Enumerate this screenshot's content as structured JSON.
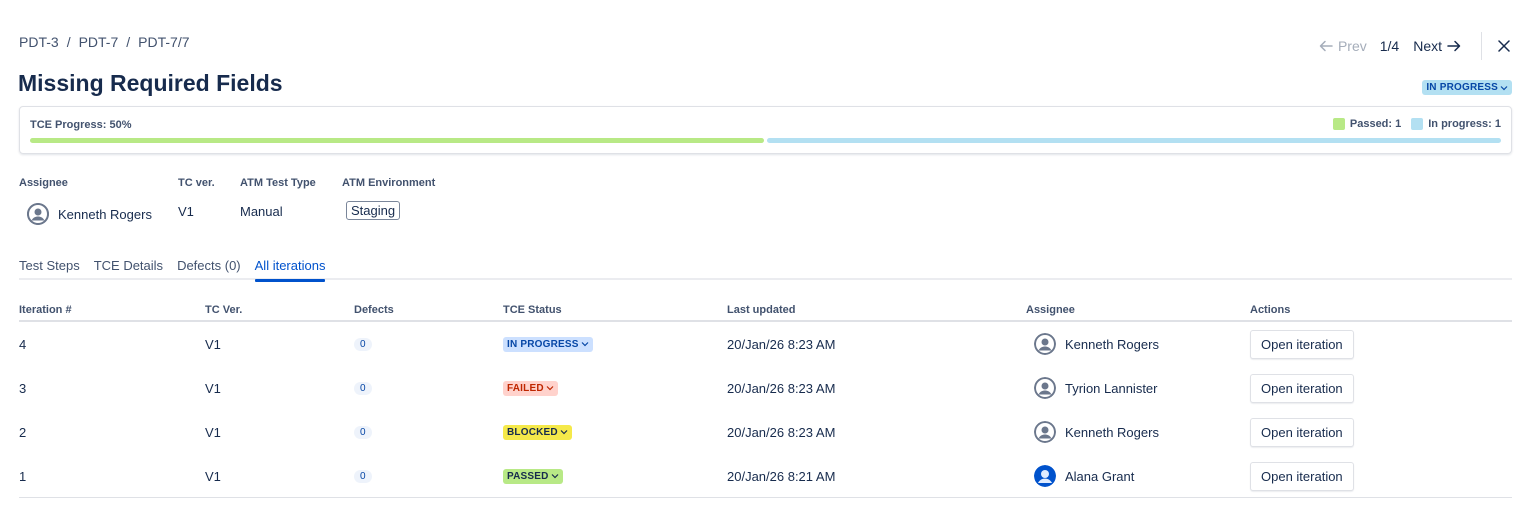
{
  "breadcrumb": {
    "items": [
      "PDT-3",
      "PDT-7",
      "PDT-7/7"
    ],
    "separator": "/"
  },
  "pager": {
    "prev_label": "Prev",
    "count": "1/4",
    "next_label": "Next"
  },
  "page_title": "Missing Required Fields",
  "header_status": "IN PROGRESS",
  "progress": {
    "label": "TCE Progress: 50%",
    "legend": [
      {
        "label": "Passed: 1",
        "color": "#b8e986"
      },
      {
        "label": "In progress: 1",
        "color": "#b3e0f2"
      }
    ],
    "segments": [
      {
        "fraction": 0.5,
        "color": "#b8e986"
      },
      {
        "fraction": 0.5,
        "color": "#b3e0f2"
      }
    ]
  },
  "fields": {
    "assignee_label": "Assignee",
    "assignee_value": "Kenneth Rogers",
    "tc_ver_label": "TC ver.",
    "tc_ver_value": "V1",
    "test_type_label": "ATM Test Type",
    "test_type_value": "Manual",
    "environment_label": "ATM Environment",
    "environment_value": "Staging"
  },
  "tabs": [
    {
      "label": "Test Steps",
      "active": false
    },
    {
      "label": "TCE Details",
      "active": false
    },
    {
      "label": "Defects (0)",
      "active": false
    },
    {
      "label": "All iterations",
      "active": true
    }
  ],
  "table": {
    "headers": {
      "iteration": "Iteration #",
      "tc_ver": "TC Ver.",
      "defects": "Defects",
      "status": "TCE Status",
      "last_updated": "Last updated",
      "assignee": "Assignee",
      "actions": "Actions"
    },
    "rows": [
      {
        "iteration": "4",
        "tc_ver": "V1",
        "defects": "0",
        "status": "IN PROGRESS",
        "status_kind": "inprogress",
        "last_updated": "20/Jan/26 8:23 AM",
        "assignee": "Kenneth Rogers",
        "avatar": "default",
        "action": "Open iteration"
      },
      {
        "iteration": "3",
        "tc_ver": "V1",
        "defects": "0",
        "status": "FAILED",
        "status_kind": "failed",
        "last_updated": "20/Jan/26 8:23 AM",
        "assignee": "Tyrion Lannister",
        "avatar": "default",
        "action": "Open iteration"
      },
      {
        "iteration": "2",
        "tc_ver": "V1",
        "defects": "0",
        "status": "BLOCKED",
        "status_kind": "blocked",
        "last_updated": "20/Jan/26 8:23 AM",
        "assignee": "Kenneth Rogers",
        "avatar": "default",
        "action": "Open iteration"
      },
      {
        "iteration": "1",
        "tc_ver": "V1",
        "defects": "0",
        "status": "PASSED",
        "status_kind": "passed",
        "last_updated": "20/Jan/26 8:21 AM",
        "assignee": "Alana Grant",
        "avatar": "blue",
        "action": "Open iteration"
      }
    ]
  },
  "colors": {
    "link_blue": "#0052cc",
    "in_progress": "#b3e0f2",
    "failed": "#ffd2cc",
    "blocked": "#f5e94a",
    "passed": "#b8e986"
  },
  "icons": {
    "prev": "arrow-left-icon",
    "next": "arrow-right-icon",
    "close": "close-icon",
    "dropdown": "chevron-down-icon",
    "avatar": "user-avatar-icon"
  }
}
